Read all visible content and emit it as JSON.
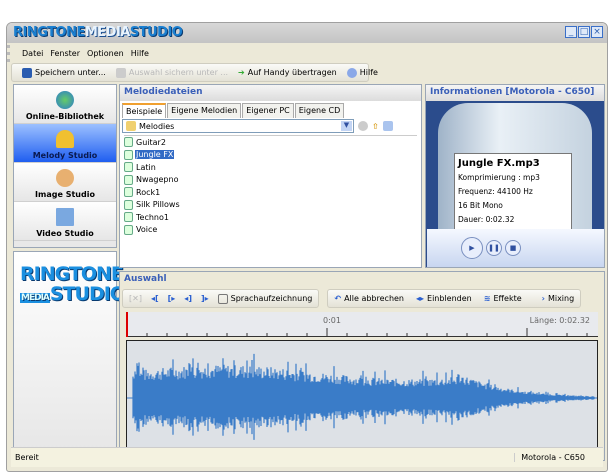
{
  "app": {
    "title_logo": "RINGTONE MEDIA STUDIO",
    "window_buttons": [
      "minimize",
      "maximize",
      "close"
    ]
  },
  "menu": [
    "Datei",
    "Fenster",
    "Optionen",
    "Hilfe"
  ],
  "toolbar": {
    "save": "Speichern unter...",
    "save_selection": "Auswahl sichern unter ...",
    "transfer": "Auf Handy übertragen",
    "help": "Hilfe"
  },
  "nav": [
    {
      "label": "Online-Bibliothek",
      "icon": "globe-icon"
    },
    {
      "label": "Melody Studio",
      "icon": "bell-icon",
      "selected": true
    },
    {
      "label": "Image Studio",
      "icon": "palette-icon"
    },
    {
      "label": "Video Studio",
      "icon": "film-icon"
    }
  ],
  "brand_logo": {
    "line1": "RINGTONE",
    "media": "MEDIA",
    "studio": "STUDIO"
  },
  "melodies": {
    "title": "Melodiedateien",
    "tabs": [
      "Beispiele",
      "Eigene Melodien",
      "Eigener PC",
      "Eigene CD"
    ],
    "folder": "Melodies",
    "files": [
      {
        "name": "Guitar2"
      },
      {
        "name": "Jungle FX",
        "selected": true
      },
      {
        "name": "Latin"
      },
      {
        "name": "Nwagepno"
      },
      {
        "name": "Rock1"
      },
      {
        "name": "Silk Pillows"
      },
      {
        "name": "Techno1"
      },
      {
        "name": "Voice"
      }
    ]
  },
  "info": {
    "title": "Informationen [Motorola - C650]",
    "file": "Jungle FX.mp3",
    "compression": "Komprimierung : mp3",
    "frequency": "Frequenz: 44100 Hz",
    "format": "16 Bit Mono",
    "duration": "Dauer: 0:02.32"
  },
  "auswahl": {
    "title": "Auswahl",
    "record": "Sprachaufzeichnung",
    "cancel_all": "Alle abbrechen",
    "fade_in": "Einblenden",
    "effects": "Effekte",
    "mixing": "Mixing",
    "ruler_mark": "0:01",
    "length": "Länge: 0:02.32",
    "waveform_color": "#3a7cc8"
  },
  "status": {
    "left": "Bereit",
    "right": "Motorola - C650"
  }
}
